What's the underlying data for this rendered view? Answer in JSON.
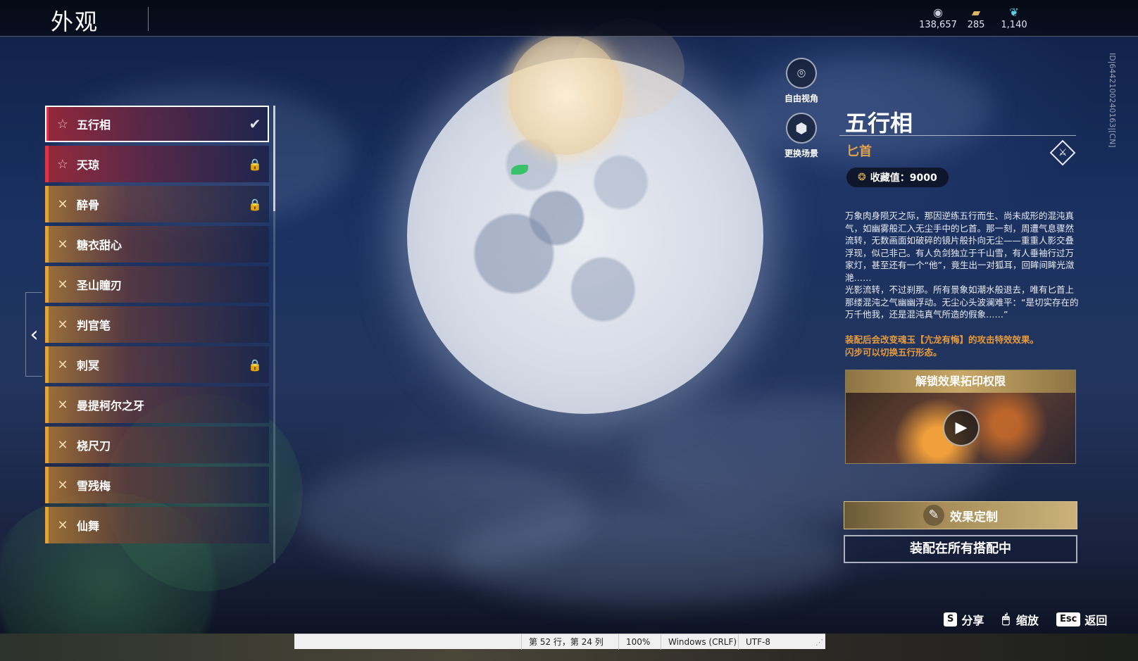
{
  "header": {
    "title": "外观",
    "currencies": [
      {
        "icon": "coin-stack-icon",
        "value": "138,657"
      },
      {
        "icon": "ticket-icon",
        "value": "285"
      },
      {
        "icon": "feather-icon",
        "value": "1,140"
      }
    ]
  },
  "list": {
    "items": [
      {
        "label": "五行相",
        "kind": "red",
        "icon": "star-icon",
        "state": "selected"
      },
      {
        "label": "天琼",
        "kind": "red",
        "icon": "star-icon",
        "state": "locked"
      },
      {
        "label": "醉骨",
        "kind": "gold",
        "icon": "cross-swords-icon",
        "state": "locked"
      },
      {
        "label": "糖衣甜心",
        "kind": "gold",
        "icon": "cross-swords-icon",
        "state": ""
      },
      {
        "label": "圣山瞳刃",
        "kind": "gold",
        "icon": "cross-swords-icon",
        "state": ""
      },
      {
        "label": "判官笔",
        "kind": "gold",
        "icon": "cross-swords-icon",
        "state": ""
      },
      {
        "label": "刺冥",
        "kind": "gold",
        "icon": "cross-swords-icon",
        "state": "locked"
      },
      {
        "label": "曼提柯尔之牙",
        "kind": "gold",
        "icon": "cross-swords-icon",
        "state": ""
      },
      {
        "label": "桡尺刀",
        "kind": "gold",
        "icon": "cross-swords-icon",
        "state": ""
      },
      {
        "label": "雪残梅",
        "kind": "gold",
        "icon": "cross-swords-icon",
        "state": ""
      },
      {
        "label": "仙舞",
        "kind": "gold",
        "icon": "cross-swords-icon",
        "state": ""
      }
    ]
  },
  "camera": {
    "free_view_label": "自由视角",
    "change_scene_label": "更换场景"
  },
  "detail": {
    "name": "五行相",
    "type": "匕首",
    "collect": "收藏值：9000",
    "description": "万象肉身陨灭之际，那因逆练五行而生、尚未成形的混沌真气，如幽雾般汇入无尘手中的匕首。那一刻，周遭气息骤然流转，无数画面如破碎的镜片般扑向无尘——重重人影交叠浮现，似己非己。有人负剑独立于千山雪，有人垂袖行过万家灯，甚至还有一个“他”，竟生出一对狐耳，回眸间眸光潋滟……\n光影流转，不过刹那。所有景象如潮水般退去，唯有匕首上那缕混沌之气幽幽浮动。无尘心头波澜难平：“是切实存在的万千他我，还是混沌真气所造的假象……”",
    "effect": "装配后会改变魂玉【亢龙有悔】的攻击特效效果。\n闪步可以切换五行形态。",
    "unlock_title": "解锁效果拓印权限",
    "custom_label": "效果定制",
    "equip_label": "装配在所有搭配中"
  },
  "id_text": "ID|6442100240163|[CN]",
  "hints": [
    {
      "key": "S",
      "label": "分享"
    },
    {
      "key": "mouse-icon",
      "label": "缩放"
    },
    {
      "key": "Esc",
      "label": "返回"
    }
  ],
  "statusbar": {
    "position": "第 52 行，第 24 列",
    "zoom": "100%",
    "line_ending": "Windows (CRLF)",
    "encoding": "UTF-8"
  }
}
